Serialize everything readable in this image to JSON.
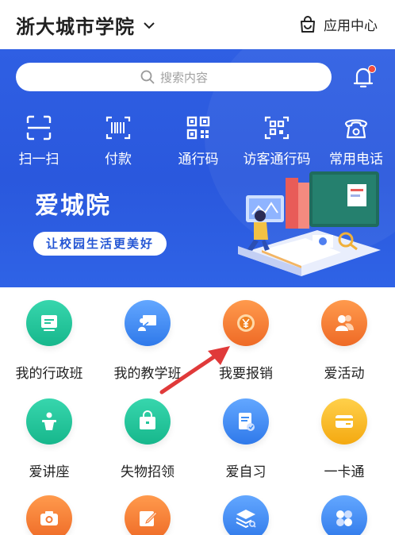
{
  "header": {
    "school_name": "浙大城市学院",
    "app_center_label": "应用中心"
  },
  "banner": {
    "search_placeholder": "搜索内容",
    "quick_actions": [
      {
        "label": "扫一扫",
        "icon": "scan-icon"
      },
      {
        "label": "付款",
        "icon": "barcode-icon"
      },
      {
        "label": "通行码",
        "icon": "qrcode-icon"
      },
      {
        "label": "访客通行码",
        "icon": "visitor-qrcode-icon"
      },
      {
        "label": "常用电话",
        "icon": "phone-icon"
      }
    ],
    "title": "爱城院",
    "slogan": "让校园生活更美好"
  },
  "apps": [
    {
      "label": "我的行政班",
      "icon": "monitor-icon",
      "color": "#21c49a"
    },
    {
      "label": "我的教学班",
      "icon": "teacher-board-icon",
      "color": "#3f8ef5"
    },
    {
      "label": "我要报销",
      "icon": "yen-coin-icon",
      "color": "#f47a35"
    },
    {
      "label": "爱活动",
      "icon": "people-icon",
      "color": "#f47a35"
    },
    {
      "label": "爱讲座",
      "icon": "podium-icon",
      "color": "#21c49a"
    },
    {
      "label": "失物招领",
      "icon": "bag-icon",
      "color": "#21c49a"
    },
    {
      "label": "爱自习",
      "icon": "document-icon",
      "color": "#3f8ef5"
    },
    {
      "label": "一卡通",
      "icon": "card-icon",
      "color": "#f6b81c"
    },
    {
      "label": "",
      "icon": "camera-icon",
      "color": "#f47a35"
    },
    {
      "label": "",
      "icon": "edit-icon",
      "color": "#f47a35"
    },
    {
      "label": "",
      "icon": "layers-search-icon",
      "color": "#3f8ef5"
    },
    {
      "label": "",
      "icon": "grid-icon",
      "color": "#3f8ef5"
    }
  ],
  "colors": {
    "banner_blue": "#2f5fe3",
    "notification_dot": "#f24c3d",
    "annotation_arrow": "#e03a3a"
  }
}
